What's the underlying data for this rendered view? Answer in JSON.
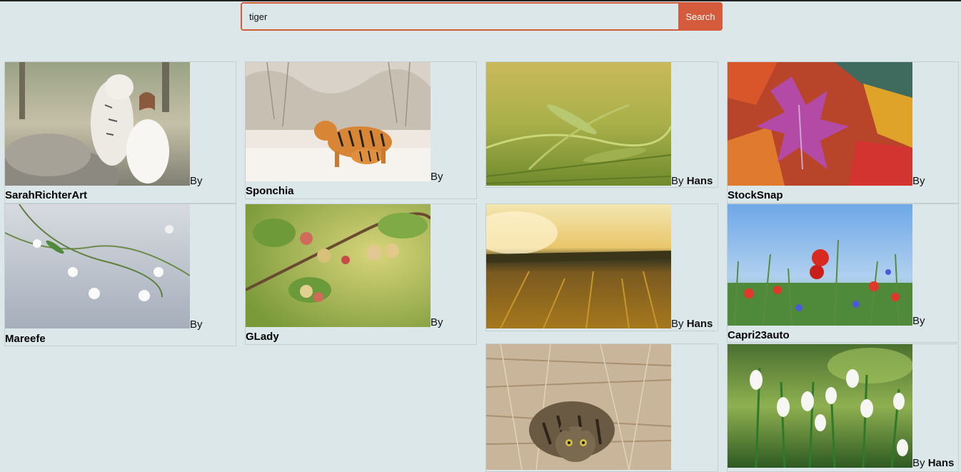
{
  "search": {
    "value": "tiger",
    "placeholder": "",
    "button_label": "Search"
  },
  "by_label": "By",
  "gallery": [
    {
      "author": "SarahRichterArt",
      "subject": "white tiger with woman on rocks"
    },
    {
      "author": "Sponchia",
      "subject": "tigers in snow"
    },
    {
      "author": "Hans",
      "subject": "green wheat field"
    },
    {
      "author": "StockSnap",
      "subject": "autumn leaves"
    },
    {
      "author": "Mareefe",
      "subject": "white flowers on branches"
    },
    {
      "author": "GLady",
      "subject": "gooseberries on branch"
    },
    {
      "author": "Hans",
      "subject": "golden field at sunset"
    },
    {
      "author": "Capri23auto",
      "subject": "poppies and cornflowers"
    },
    {
      "author": "",
      "subject": "tabby cat in dry grass"
    },
    {
      "author": "Hans",
      "subject": "snowdrops"
    }
  ],
  "colors": {
    "background": "#dbe7e8",
    "accent": "#d45b3c"
  }
}
